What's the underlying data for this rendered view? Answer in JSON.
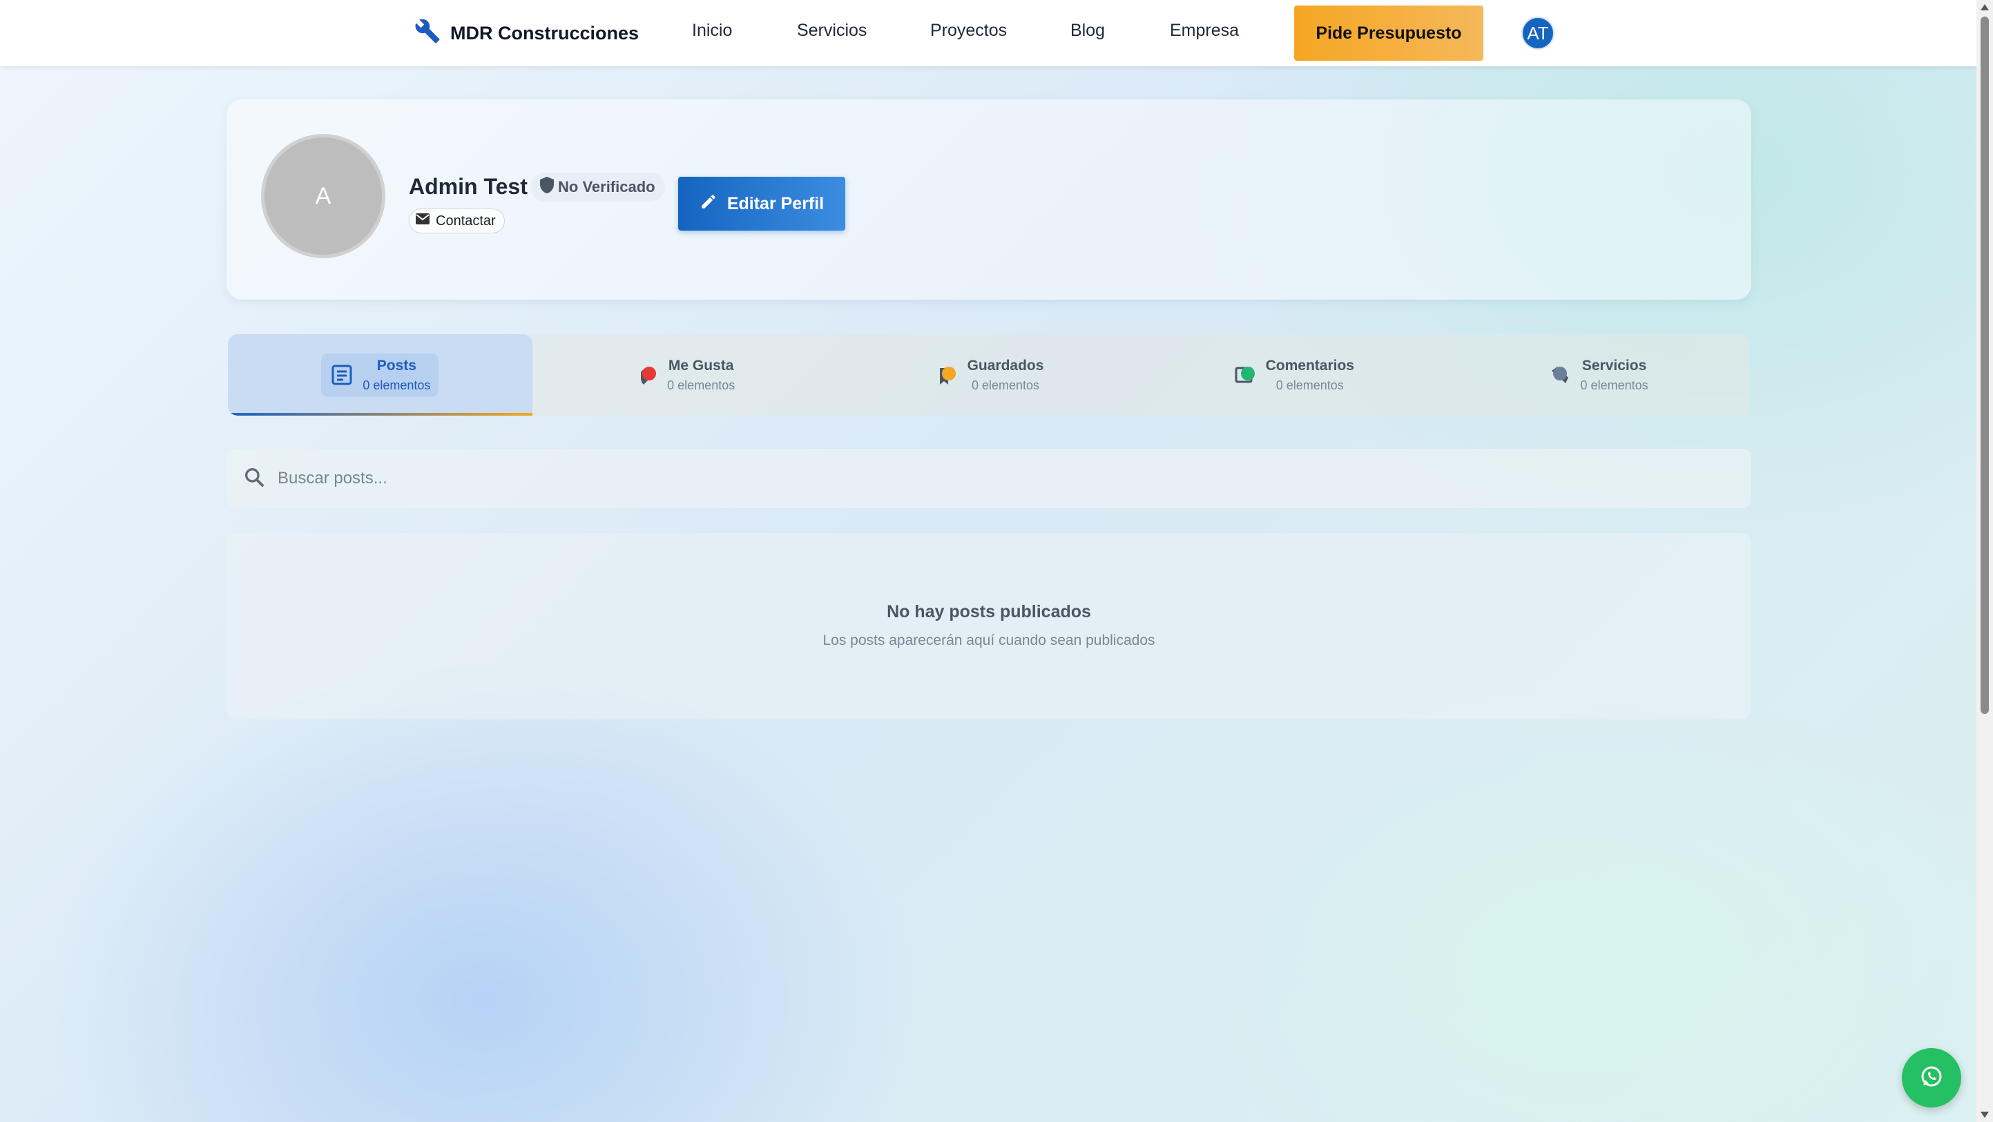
{
  "nav": {
    "brand": "MDR Construcciones",
    "brand_icon": "wrench-icon",
    "links": [
      "Inicio",
      "Servicios",
      "Proyectos",
      "Blog",
      "Empresa"
    ],
    "cta": "Pide Presupuesto",
    "user_initials": "AT"
  },
  "profile": {
    "avatar_letter": "A",
    "name": "Admin Test",
    "verification": "No Verificado",
    "contact": "Contactar",
    "edit_button": "Editar Perfil"
  },
  "tabs": [
    {
      "label": "Posts",
      "count": "0 elementos",
      "icon": "document-icon",
      "active": true
    },
    {
      "label": "Me Gusta",
      "count": "0 elementos",
      "icon": "heart-icon",
      "active": false
    },
    {
      "label": "Guardados",
      "count": "0 elementos",
      "icon": "bookmark-icon",
      "active": false
    },
    {
      "label": "Comentarios",
      "count": "0 elementos",
      "icon": "comment-icon",
      "active": false
    },
    {
      "label": "Servicios",
      "count": "0 elementos",
      "icon": "tool-icon",
      "active": false
    }
  ],
  "search": {
    "placeholder": "Buscar posts..."
  },
  "empty": {
    "title": "No hay posts publicados",
    "subtitle": "Los posts aparecerán aquí cuando sean publicados"
  },
  "colors": {
    "primary": "#1565c0",
    "accent": "#f5a623",
    "whatsapp": "#25c063"
  }
}
